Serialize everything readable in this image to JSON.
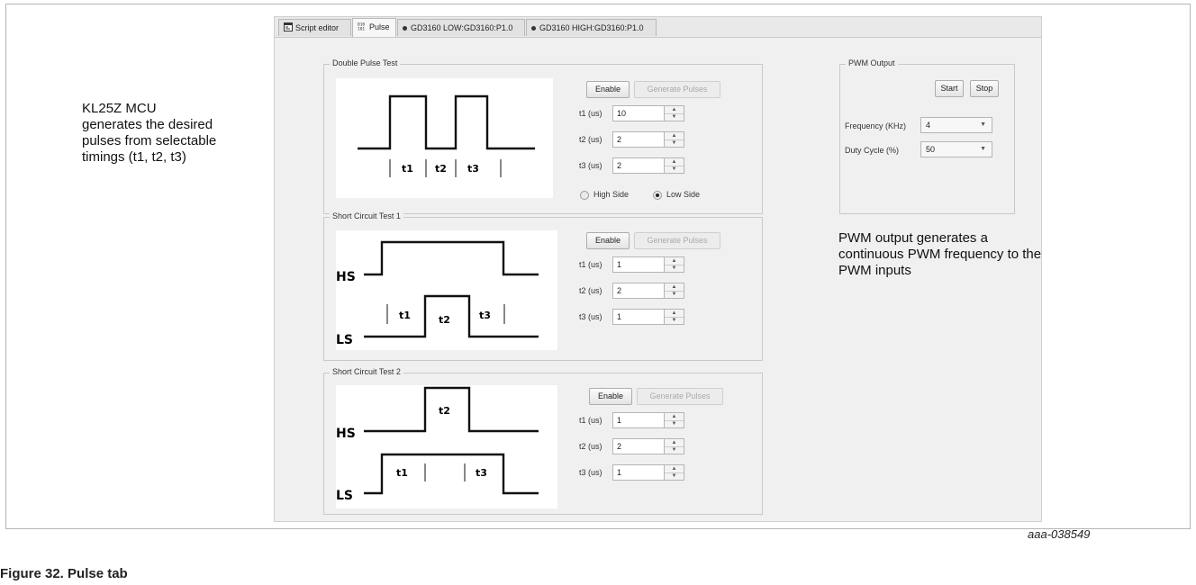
{
  "tabs": [
    {
      "label": "Script editor",
      "icon": "script-editor-icon"
    },
    {
      "label": "Pulse",
      "icon": "pulse-icon"
    },
    {
      "label": "GD3160 LOW:GD3160:P1.0",
      "icon": "status-dot-icon"
    },
    {
      "label": "GD3160 HIGH:GD3160:P1.0",
      "icon": "status-dot-icon"
    }
  ],
  "double_pulse": {
    "title": "Double Pulse Test",
    "enable": "Enable",
    "generate": "Generate Pulses",
    "t1_label": "t1 (us)",
    "t1_value": "10",
    "t2_label": "t2 (us)",
    "t2_value": "2",
    "t3_label": "t3 (us)",
    "t3_value": "2",
    "high_side": "High Side",
    "low_side": "Low Side",
    "selected_side": "Low Side",
    "diagram": {
      "t1": "t1",
      "t2": "t2",
      "t3": "t3"
    }
  },
  "short1": {
    "title": "Short Circuit Test 1",
    "enable": "Enable",
    "generate": "Generate Pulses",
    "t1_label": "t1 (us)",
    "t1_value": "1",
    "t2_label": "t2 (us)",
    "t2_value": "2",
    "t3_label": "t3 (us)",
    "t3_value": "1",
    "diagram": {
      "hs": "HS",
      "ls": "LS",
      "t1": "t1",
      "t2": "t2",
      "t3": "t3"
    }
  },
  "short2": {
    "title": "Short Circuit Test 2",
    "enable": "Enable",
    "generate": "Generate Pulses",
    "t1_label": "t1 (us)",
    "t1_value": "1",
    "t2_label": "t2 (us)",
    "t2_value": "2",
    "t3_label": "t3 (us)",
    "t3_value": "1",
    "diagram": {
      "hs": "HS",
      "ls": "LS",
      "t1": "t1",
      "t2": "t2",
      "t3": "t3"
    }
  },
  "pwm": {
    "title": "PWM Output",
    "start": "Start",
    "stop": "Stop",
    "freq_label": "Frequency (KHz)",
    "freq_value": "4",
    "duty_label": "Duty Cycle (%)",
    "duty_value": "50"
  },
  "notes": {
    "left_line1": "KL25Z MCU",
    "left_line2": "generates the desired",
    "left_line3": "pulses from selectable",
    "left_line4": "timings (t1, t2, t3)",
    "right_line1": "PWM output generates a",
    "right_line2": "continuous PWM frequency to the",
    "right_line3": "PWM inputs"
  },
  "figure_id": "aaa-038549",
  "caption": "Figure 32.  Pulse tab"
}
